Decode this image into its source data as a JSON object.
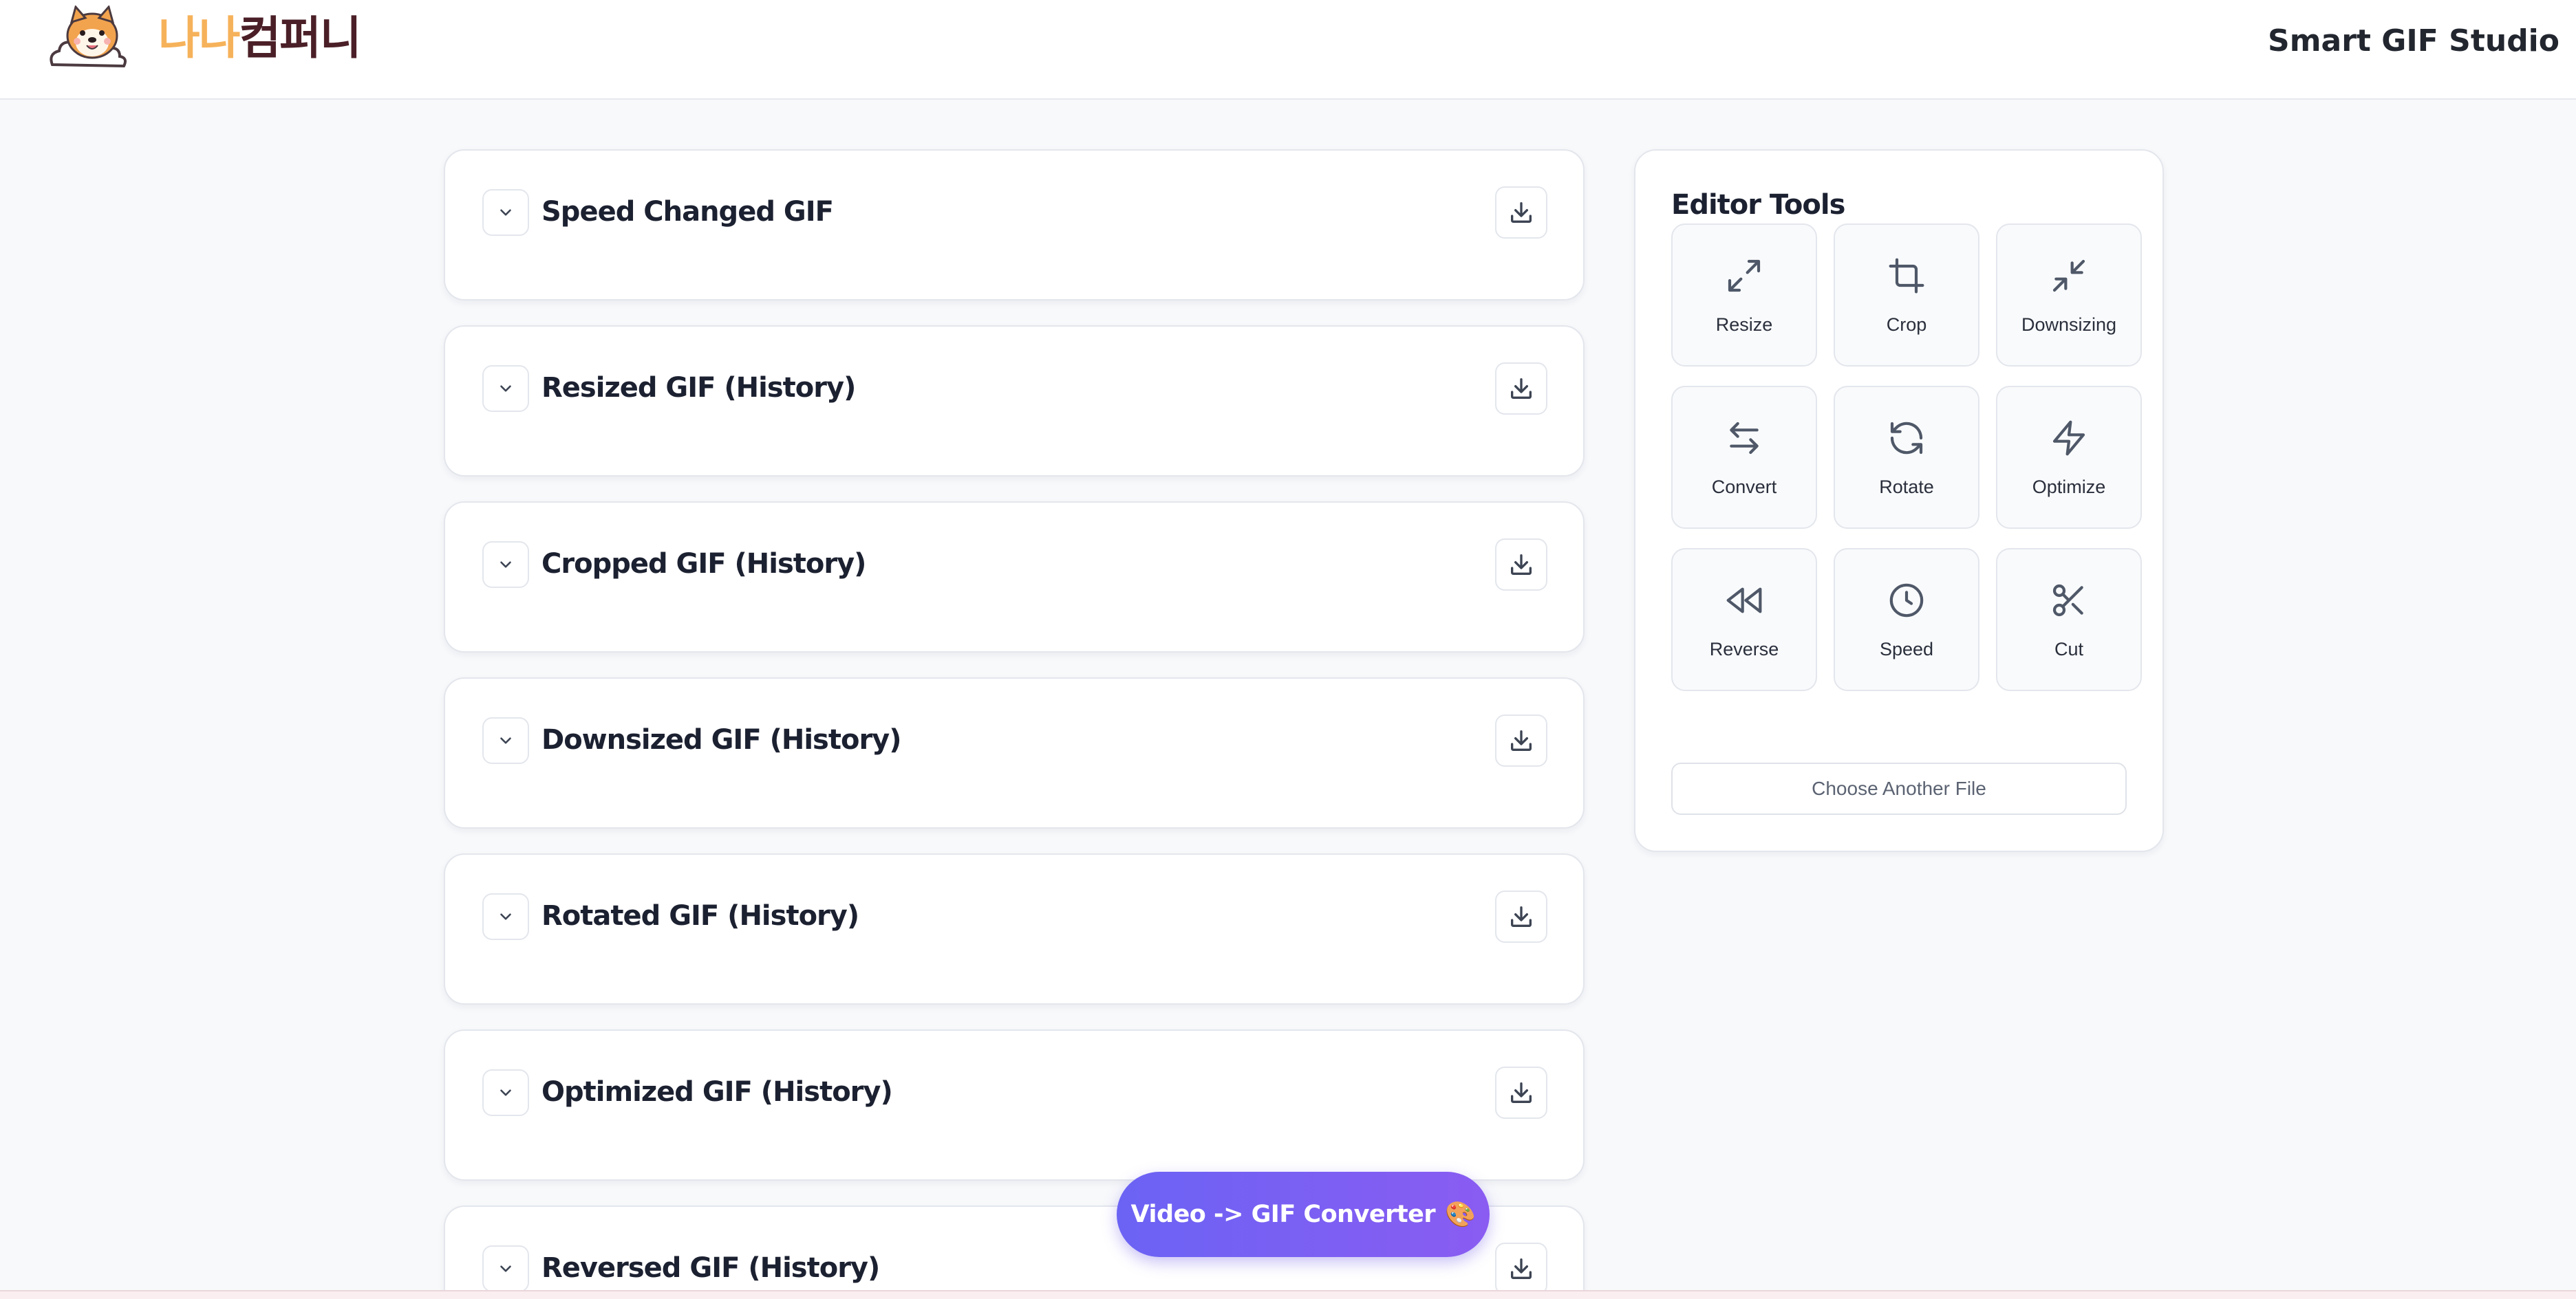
{
  "header": {
    "logo_part1": "나나",
    "logo_part2": "컴퍼니",
    "app_title": "Smart GIF Studio"
  },
  "history": {
    "cards": [
      {
        "title": "Speed Changed GIF"
      },
      {
        "title": "Resized GIF (History)"
      },
      {
        "title": "Cropped GIF (History)"
      },
      {
        "title": "Downsized GIF (History)"
      },
      {
        "title": "Rotated GIF (History)"
      },
      {
        "title": "Optimized GIF (History)"
      },
      {
        "title": "Reversed GIF (History)"
      }
    ]
  },
  "editor": {
    "title": "Editor Tools",
    "tools": [
      {
        "label": "Resize",
        "icon": "resize-icon"
      },
      {
        "label": "Crop",
        "icon": "crop-icon"
      },
      {
        "label": "Downsizing",
        "icon": "downsize-icon"
      },
      {
        "label": "Convert",
        "icon": "convert-icon"
      },
      {
        "label": "Rotate",
        "icon": "rotate-icon"
      },
      {
        "label": "Optimize",
        "icon": "lightning-icon"
      },
      {
        "label": "Reverse",
        "icon": "rewind-icon"
      },
      {
        "label": "Speed",
        "icon": "clock-icon"
      },
      {
        "label": "Cut",
        "icon": "scissors-icon"
      }
    ],
    "choose_file_label": "Choose Another File"
  },
  "fab": {
    "label": "Video -> GIF Converter",
    "emoji": "🎨"
  },
  "colors": {
    "accent_start": "#6b63f4",
    "accent_end": "#8a5cf2",
    "icon_stroke": "#4f5868"
  }
}
